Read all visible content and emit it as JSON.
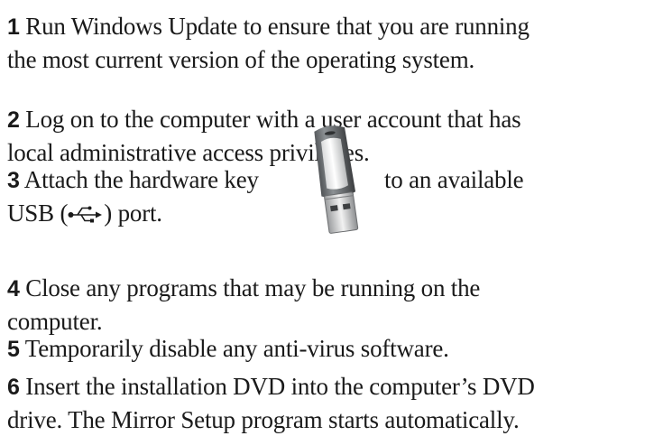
{
  "steps": [
    {
      "number": "1",
      "lines": [
        "Run Windows Update to ensure that you are running",
        "the most current version of the operating system."
      ]
    },
    {
      "number": "2",
      "lines": [
        "Log on to the computer with a user account that has",
        "local administrative access privileges."
      ]
    },
    {
      "number": "3",
      "line1_before": "Attach the hardware key",
      "line1_after": "to an available",
      "line2_before": "USB (",
      "usb_symbol": "usb-icon",
      "line2_after": ") port."
    },
    {
      "number": "4",
      "lines": [
        "Close any programs that may be running on the",
        "computer."
      ]
    },
    {
      "number": "5",
      "lines": [
        "Temporarily disable any anti-virus software."
      ]
    },
    {
      "number": "6",
      "lines": [
        "Insert the installation DVD into the computer’s DVD",
        "drive. The Mirror Setup program starts automatically."
      ]
    }
  ],
  "images": {
    "hardware_key": "usb-hardware-key-image"
  }
}
